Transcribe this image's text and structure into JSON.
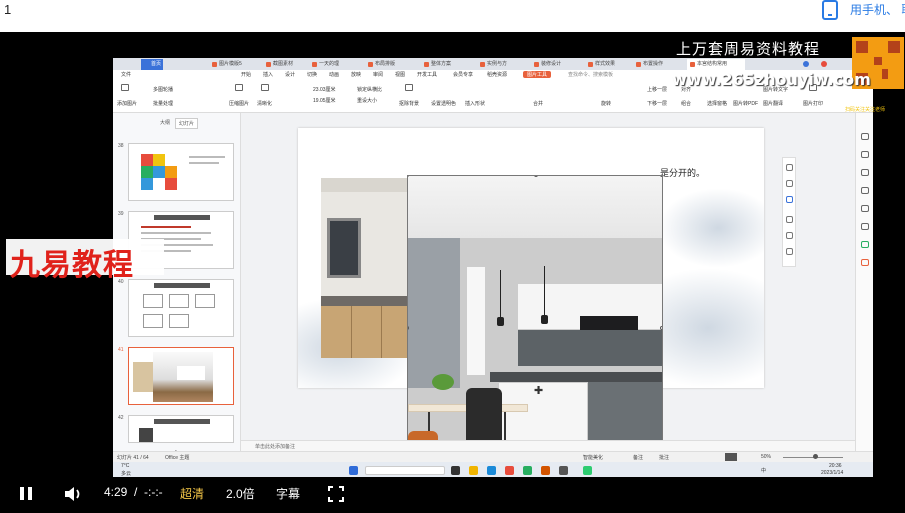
{
  "page": {
    "number": "1"
  },
  "top_link": {
    "label": "用手机、 联"
  },
  "wps": {
    "tabs": [
      {
        "label": "首页"
      },
      {
        "label": "图片模版5"
      },
      {
        "label": "截图素材"
      },
      {
        "label": "一天的理"
      },
      {
        "label": "布局排版"
      },
      {
        "label": "整体方案"
      },
      {
        "label": "实例与方"
      },
      {
        "label": "装修设计"
      },
      {
        "label": "样式效果"
      },
      {
        "label": "布置操作"
      },
      {
        "label": "本宫结构常用"
      }
    ],
    "menu": [
      {
        "label": "文件"
      },
      {
        "label": "开始"
      },
      {
        "label": "插入"
      },
      {
        "label": "设计"
      },
      {
        "label": "切换"
      },
      {
        "label": "动画"
      },
      {
        "label": "放映"
      },
      {
        "label": "审阅"
      },
      {
        "label": "视图"
      },
      {
        "label": "开发工具"
      },
      {
        "label": "会员专享"
      },
      {
        "label": "稻壳资源"
      },
      {
        "label": "图片工具"
      },
      {
        "label": "查找命令、搜索模板"
      }
    ],
    "ribbon": [
      {
        "label": "添加图片"
      },
      {
        "label": "多图轮播"
      },
      {
        "label": "批量处理"
      },
      {
        "label": "压缩图片"
      },
      {
        "label": "清晰化"
      },
      {
        "label": "抠除背景"
      },
      {
        "label": "设置透明色"
      },
      {
        "label": "图片转PDF"
      },
      {
        "label": "图片转文字"
      },
      {
        "label": "图片翻译"
      },
      {
        "label": "图片打印"
      },
      {
        "label": "23.03厘米"
      },
      {
        "label": "19.05厘米"
      },
      {
        "label": "锁定纵横比"
      },
      {
        "label": "重设大小"
      },
      {
        "label": "插入形状"
      },
      {
        "label": "合并"
      },
      {
        "label": "旋转"
      },
      {
        "label": "上移一层"
      },
      {
        "label": "下移一层"
      },
      {
        "label": "对齐"
      },
      {
        "label": "组合"
      },
      {
        "label": "选择窗格"
      }
    ],
    "panel_tabs": [
      {
        "label": "大纲"
      },
      {
        "label": "幻灯片"
      }
    ],
    "thumbs": [
      {
        "num": "38"
      },
      {
        "num": "39"
      },
      {
        "num": "40"
      },
      {
        "num": "41"
      },
      {
        "num": "42"
      }
    ],
    "slide_text": "是分开的。",
    "notes_placeholder": "单击此处添加备注",
    "status": {
      "slide_count": "幻灯片 41 / 64",
      "theme": "Office 主题",
      "smart": "智能美化",
      "notes": "备注",
      "comment": "批注",
      "zoom": "50%"
    },
    "taskbar": {
      "weather_temp": "7°C",
      "weather_desc": "多云",
      "time": "20:36",
      "date": "2023/1/14",
      "lang": "中"
    }
  },
  "watermark": {
    "text": "上万套周易资料教程",
    "url": "www.265zhouyiw.com",
    "small": "扫码关注关注老师"
  },
  "banner": {
    "text": "九易教程"
  },
  "player": {
    "time_current": "4:29",
    "time_separator": "/",
    "time_total": "-:-:-",
    "quality": "超清",
    "speed": "2.0倍",
    "subtitles": "字幕"
  }
}
